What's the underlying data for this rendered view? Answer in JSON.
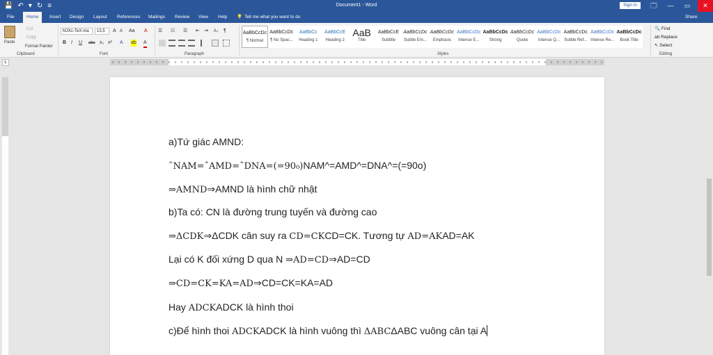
{
  "window": {
    "title": "Document1 - Word",
    "signin": "Sign in",
    "min_glyph": "🗔",
    "max_glyph": "▭",
    "close_glyph": "✕",
    "restore_glyph": "—"
  },
  "qat": {
    "save": "💾",
    "undo": "↶",
    "undo_arrow": "▾",
    "redo": "↻",
    "customize": "≡"
  },
  "tabs": [
    "File",
    "Home",
    "Insert",
    "Design",
    "Layout",
    "References",
    "Mailings",
    "Review",
    "View",
    "Help"
  ],
  "tellme": {
    "icon": "💡",
    "text": "Tell me what you want to do"
  },
  "share": "Share",
  "clipboard": {
    "paste": "Paste",
    "cut": "Cut",
    "copy": "Copy",
    "format_painter": "Format Painter",
    "label": "Clipboard"
  },
  "font": {
    "name": "MJXc-TeX-ma",
    "size": "13,5",
    "grow": "A",
    "shrink": "A",
    "case": "Aa",
    "clear": "A",
    "bold": "B",
    "italic": "I",
    "underline": "U",
    "strike": "abc",
    "sub": "x₂",
    "sup": "x²",
    "effects": "A",
    "highlight": "ab",
    "color": "A",
    "label": "Font"
  },
  "paragraph": {
    "bullets": "☰",
    "numbering": "☷",
    "multilevel": "☰",
    "dec_indent": "⇤",
    "inc_indent": "⇥",
    "sort": "A↓",
    "pilcrow": "¶",
    "label": "Paragraph"
  },
  "styles": {
    "label": "Styles",
    "items": [
      {
        "preview": "AaBbCcDc",
        "name": "¶ Normal"
      },
      {
        "preview": "AaBbCcDc",
        "name": "¶ No Spac..."
      },
      {
        "preview": "AaBbCc",
        "name": "Heading 1"
      },
      {
        "preview": "AaBbCcE",
        "name": "Heading 2"
      },
      {
        "preview": "AaB",
        "name": "Title"
      },
      {
        "preview": "AaBbCcE",
        "name": "Subtitle"
      },
      {
        "preview": "AaBbCcDc",
        "name": "Subtle Em..."
      },
      {
        "preview": "AaBbCcDc",
        "name": "Emphasis"
      },
      {
        "preview": "AaBbCcDc",
        "name": "Intense E..."
      },
      {
        "preview": "AaBbCcDc",
        "name": "Strong"
      },
      {
        "preview": "AaBbCcDc",
        "name": "Quote"
      },
      {
        "preview": "AaBbCcDc",
        "name": "Intense Q..."
      },
      {
        "preview": "AaBbCcDc",
        "name": "Subtle Ref..."
      },
      {
        "preview": "AaBbCcDc",
        "name": "Intense Re..."
      },
      {
        "preview": "AaBbCcDc",
        "name": "Book Title"
      }
    ]
  },
  "editing": {
    "find": "Find",
    "replace": "Replace",
    "select": "Select",
    "label": "Editing"
  },
  "document": {
    "p1": "a)Tứ giác AMND:",
    "p2_math": "ˆNAM=ˆAMD=ˆDNA=(=90₀)",
    "p2_text": "NAM^=AMD^=DNA^=(=90o)",
    "p3_math": "⇒AMND",
    "p3_text": "⇒AMND là hình chữ nhật",
    "p4": "b)Ta có: CN là đường trung tuyến và đường cao",
    "p5_math1": "⇒ΔCDK",
    "p5_text1": "⇒ΔCDK cân suy ra ",
    "p5_math2": "CD=CK",
    "p5_text2": "CD=CK. Tương tự ",
    "p5_math3": "AD=AK",
    "p5_text3": "AD=AK",
    "p6_text1": "Lại có K đối xứng D qua N ",
    "p6_math": "⇒AD=CD",
    "p6_text2": "⇒AD=CD",
    "p7_math": "⇒CD=CK=KA=AD",
    "p7_text": "⇒CD=CK=KA=AD",
    "p8_text1": "Hay ",
    "p8_math": "ADCK",
    "p8_text2": "ADCK là hình thoi",
    "p9_text1": "c)Để hình thoi ",
    "p9_math1": "ADCK",
    "p9_text2": "ADCK là hình vuông thì ",
    "p9_math2": "ΔABC",
    "p9_text3": "ΔABC vuông cân tại A"
  }
}
